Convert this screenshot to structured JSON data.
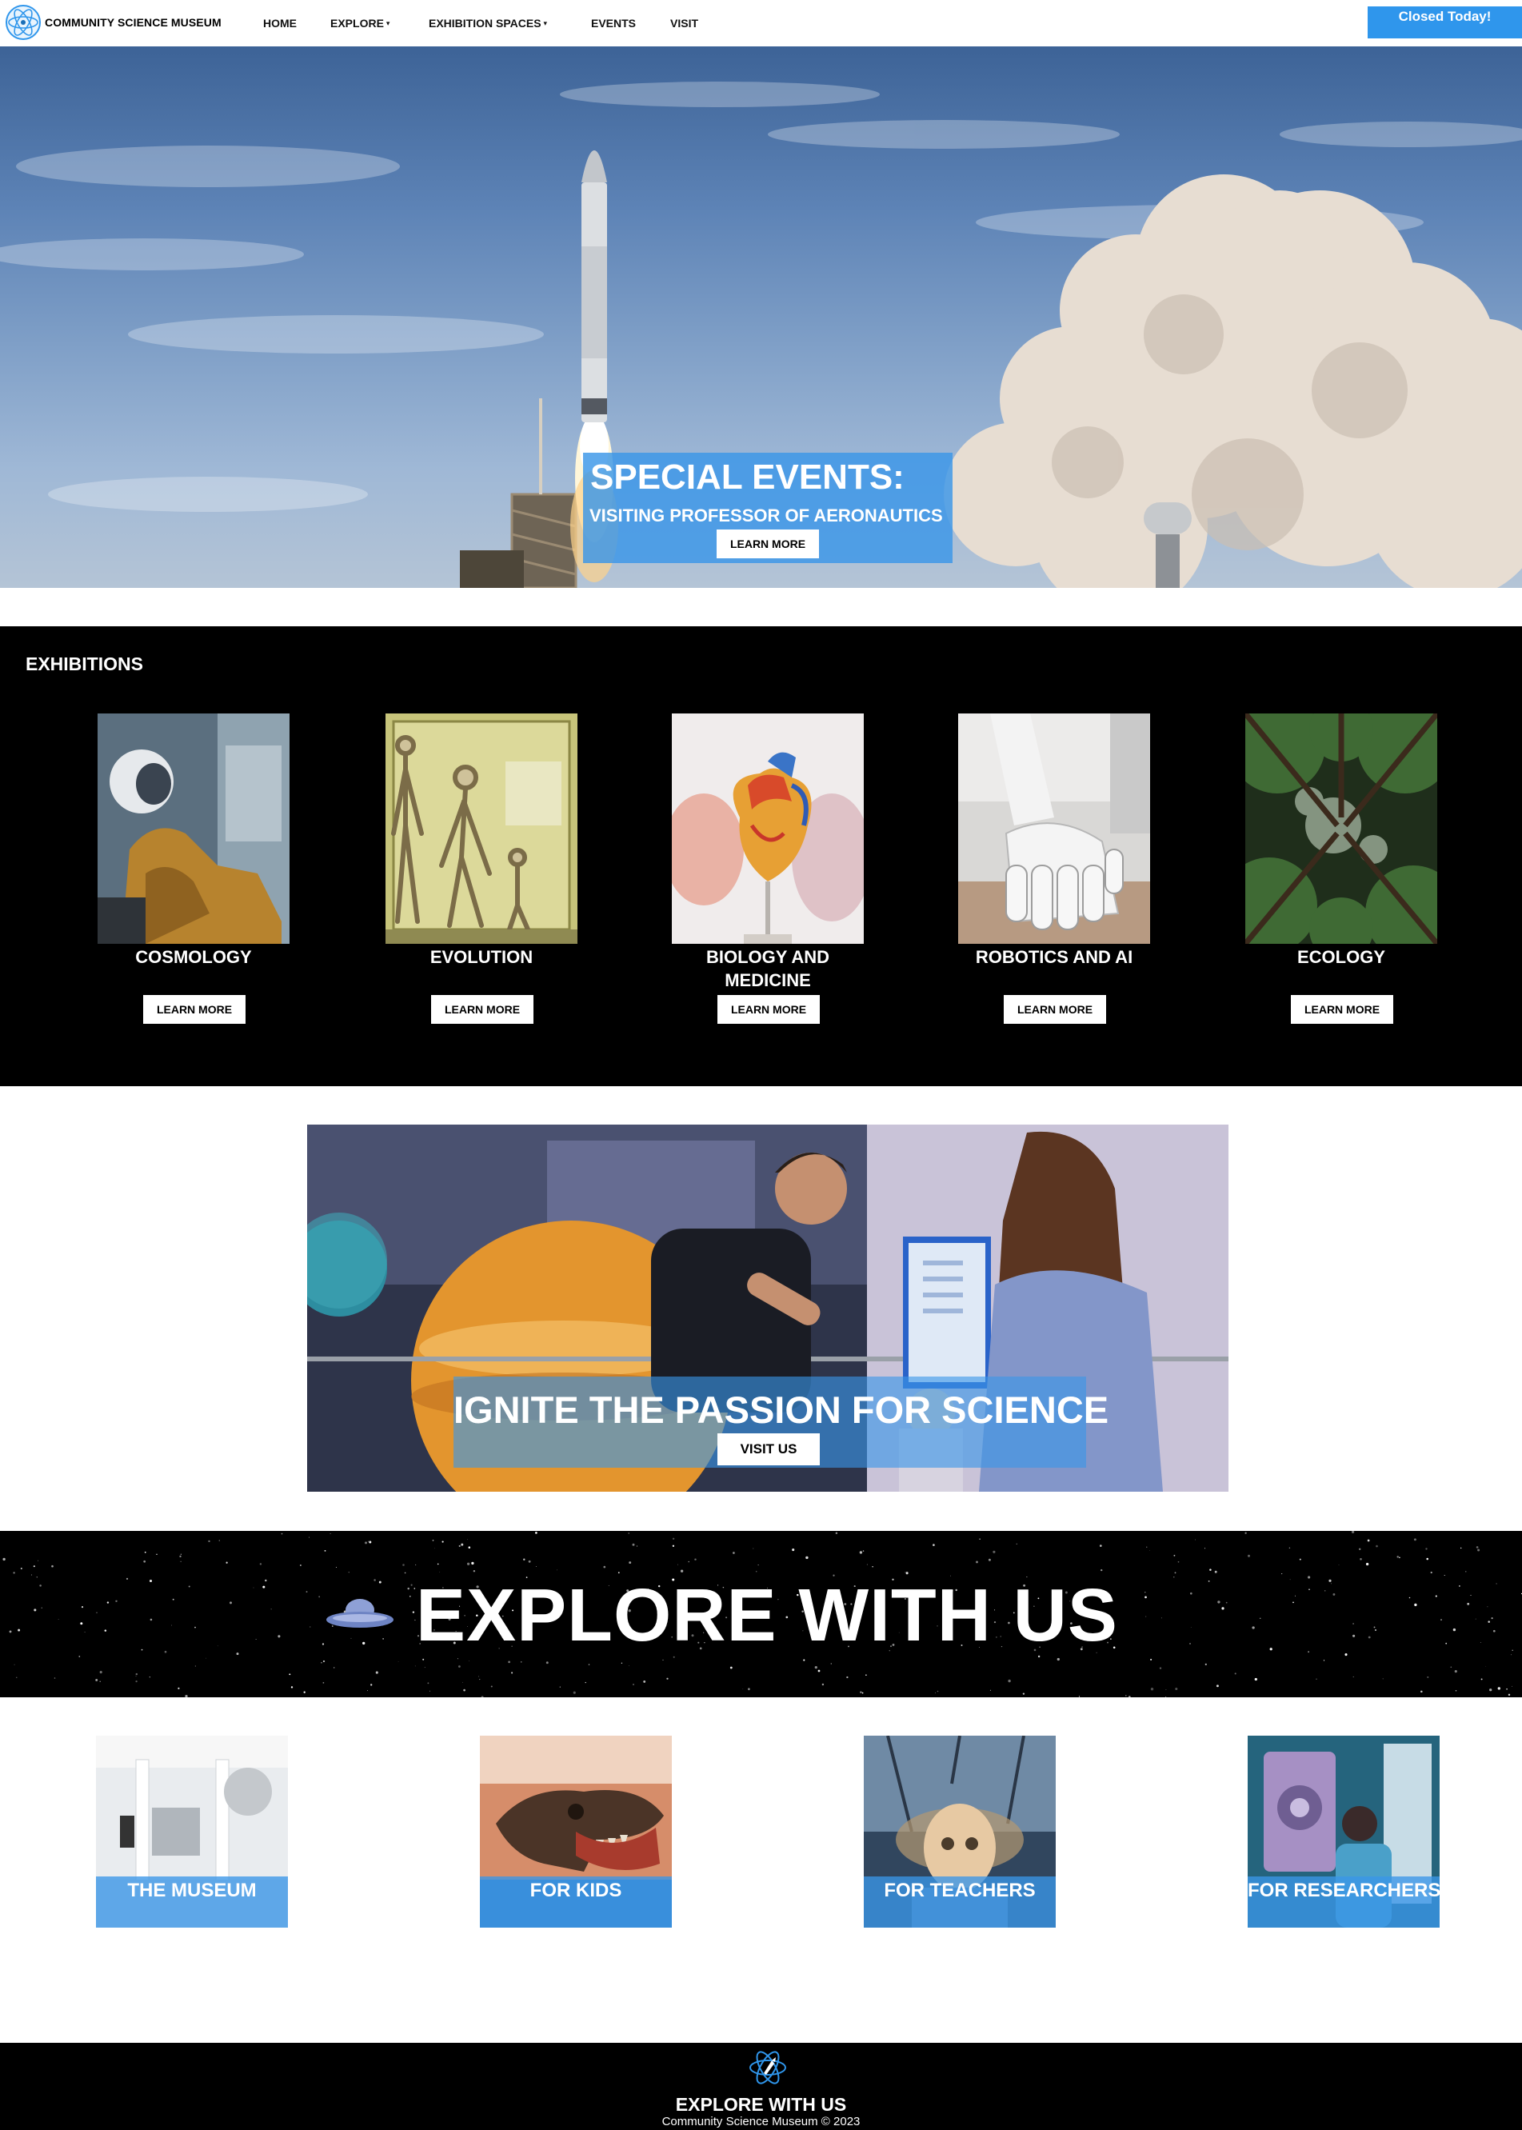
{
  "nav": {
    "brand": "COMMUNITY SCIENCE MUSEUM",
    "links": [
      {
        "label": "HOME",
        "has_caret": false
      },
      {
        "label": "EXPLORE",
        "has_caret": true
      },
      {
        "label": "EXHIBITION SPACES",
        "has_caret": true
      },
      {
        "label": "EVENTS",
        "has_caret": false
      },
      {
        "label": "VISIT",
        "has_caret": false
      }
    ],
    "caret": "▾",
    "status": "Closed Today!"
  },
  "hero": {
    "title": "SPECIAL EVENTS:",
    "subtitle": "VISITING PROFESSOR OF AERONAUTICS",
    "button": "LEARN MORE",
    "image_icon": "rocket-launch-image"
  },
  "exhibitions": {
    "heading": "EXHIBITIONS",
    "items": [
      {
        "name": "COSMOLOGY",
        "button": "LEARN MORE",
        "image_icon": "astronaut-suit-image"
      },
      {
        "name": "EVOLUTION",
        "button": "LEARN MORE",
        "image_icon": "skeletons-display-image"
      },
      {
        "name": "BIOLOGY AND MEDICINE",
        "button": "LEARN MORE",
        "image_icon": "heart-model-image"
      },
      {
        "name": "ROBOTICS AND AI",
        "button": "LEARN MORE",
        "image_icon": "robot-hand-image"
      },
      {
        "name": "ECOLOGY",
        "button": "LEARN MORE",
        "image_icon": "forest-canopy-image"
      }
    ]
  },
  "promo": {
    "title": "IGNITE THE PASSION FOR SCIENCE",
    "button": "VISIT US",
    "image_icon": "planetarium-visitors-image"
  },
  "explore_banner": {
    "title": "EXPLORE WITH US",
    "icon": "ufo-icon"
  },
  "audiences": [
    {
      "label": "THE MUSEUM",
      "image_icon": "museum-hall-image"
    },
    {
      "label": "FOR KIDS",
      "image_icon": "dinosaur-skull-image"
    },
    {
      "label": "FOR TEACHERS",
      "image_icon": "skeleton-model-image"
    },
    {
      "label": "FOR RESEARCHERS",
      "image_icon": "lab-researcher-image"
    }
  ],
  "footer": {
    "title": "EXPLORE WITH US",
    "copyright": "Community Science Museum © 2023"
  },
  "colors": {
    "accent_blue": "#2f96ec",
    "overlay_blue": "#3a96e8",
    "dark": "#000000",
    "light": "#ffffff"
  }
}
